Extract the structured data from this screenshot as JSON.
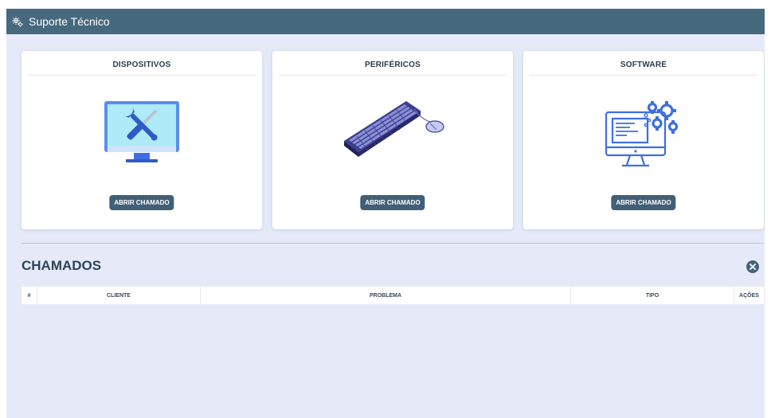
{
  "header": {
    "title": "Suporte Técnico",
    "logo_icon": "gear-cog-icon",
    "bg_color": "#46697e"
  },
  "cards": [
    {
      "title": "DISPOSITIVOS",
      "button_label": "ABRIR CHAMADO",
      "illustration": "monitor-tools-illustration"
    },
    {
      "title": "PERIFÉRICOS",
      "button_label": "ABRIR CHAMADO",
      "illustration": "keyboard-mouse-illustration"
    },
    {
      "title": "SOFTWARE",
      "button_label": "ABRIR CHAMADO",
      "illustration": "monitor-gears-illustration"
    }
  ],
  "section": {
    "title": "CHAMADOS",
    "close_icon": "close-circle-icon"
  },
  "table": {
    "headers": [
      "#",
      "CLIENTE",
      "PROBLEMA",
      "TIPO",
      "AÇÕES"
    ],
    "rows": []
  },
  "colors": {
    "accent": "#415f77",
    "page_bg": "#e6eaf8",
    "illustration_blue": "#3d6fe0"
  }
}
